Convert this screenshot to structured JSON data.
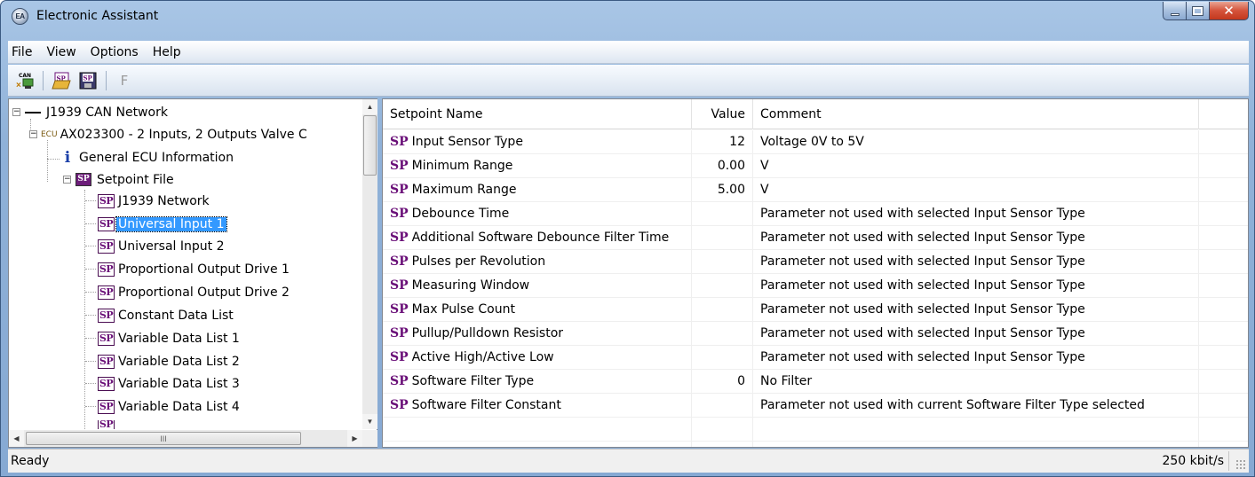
{
  "window": {
    "title": "Electronic Assistant",
    "app_icon_text": "EA",
    "close_glyph": "✕"
  },
  "menu": {
    "items": [
      "File",
      "View",
      "Options",
      "Help"
    ]
  },
  "toolbar": {
    "can_label": "CAN",
    "sp_open_label": "SP",
    "sp_save_label": "SP",
    "f_label": "F",
    "icons": [
      "can-connect-icon",
      "open-setpoint-file-icon",
      "save-setpoint-file-icon",
      "flash-icon"
    ]
  },
  "tree": {
    "network": "J1939 CAN Network",
    "ecu_tag": "ECU",
    "ecu": "AX023300 - 2 Inputs, 2 Outputs Valve C",
    "info_glyph": "i",
    "general_info": "General ECU Information",
    "setpoint_folder_icon": "SP",
    "setpoint_file": "Setpoint File",
    "sp_icon": "SP",
    "setpoint_items": [
      "J1939 Network",
      "Universal Input 1",
      "Universal Input 2",
      "Proportional Output Drive 1",
      "Proportional Output Drive 2",
      "Constant Data List",
      "Variable Data List 1",
      "Variable Data List 2",
      "Variable Data List 3",
      "Variable Data List 4"
    ],
    "selected_index": 1,
    "hscroll_glyph": "III"
  },
  "table": {
    "headers": {
      "name": "Setpoint Name",
      "value": "Value",
      "comment": "Comment"
    },
    "sp_prefix": "SP",
    "rows": [
      {
        "name": "Input Sensor Type",
        "value": "12",
        "comment": "Voltage 0V to 5V"
      },
      {
        "name": "Minimum Range",
        "value": "0.00",
        "comment": "V"
      },
      {
        "name": "Maximum Range",
        "value": "5.00",
        "comment": "V"
      },
      {
        "name": "Debounce Time",
        "value": "",
        "comment": "Parameter not used with selected Input Sensor Type"
      },
      {
        "name": "Additional Software Debounce Filter Time",
        "value": "",
        "comment": "Parameter not used with selected Input Sensor Type"
      },
      {
        "name": "Pulses per Revolution",
        "value": "",
        "comment": "Parameter not used with selected Input Sensor Type"
      },
      {
        "name": "Measuring Window",
        "value": "",
        "comment": "Parameter not used with selected Input Sensor Type"
      },
      {
        "name": "Max Pulse Count",
        "value": "",
        "comment": "Parameter not used with selected Input Sensor Type"
      },
      {
        "name": "Pullup/Pulldown Resistor",
        "value": "",
        "comment": "Parameter not used with selected Input Sensor Type"
      },
      {
        "name": "Active High/Active Low",
        "value": "",
        "comment": "Parameter not used with selected Input Sensor Type"
      },
      {
        "name": "Software Filter Type",
        "value": "0",
        "comment": "No Filter"
      },
      {
        "name": "Software Filter Constant",
        "value": "",
        "comment": "Parameter not used with current Software Filter Type selected"
      }
    ]
  },
  "status": {
    "text": "Ready",
    "baud": "250 kbit/s"
  },
  "colors": {
    "sp_purple": "#6a0f78",
    "selection_blue": "#3399ff",
    "title_blue": "#8fb1d8",
    "close_red": "#c3381d"
  }
}
